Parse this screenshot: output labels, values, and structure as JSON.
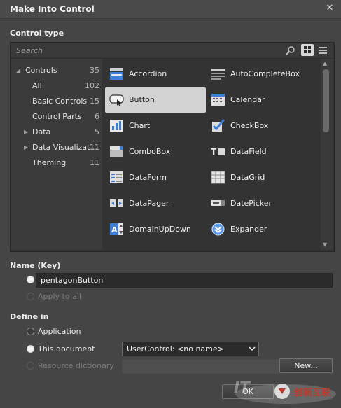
{
  "dialog": {
    "title": "Make Into Control",
    "close_glyph": "✕"
  },
  "control_type": {
    "heading": "Control type",
    "search_placeholder": "Search",
    "tree": [
      {
        "label": "Controls",
        "count": "35",
        "arrow": "◢"
      },
      {
        "label": "All",
        "count": "102"
      },
      {
        "label": "Basic Controls",
        "count": "15"
      },
      {
        "label": "Control Parts",
        "count": "6"
      },
      {
        "label": "Data",
        "count": "5",
        "arrow": "▶"
      },
      {
        "label": "Data Visualizat...",
        "count": "11",
        "arrow": "▶"
      },
      {
        "label": "Theming",
        "count": "11"
      }
    ],
    "items": [
      {
        "label": "Accordion",
        "icon": "accordion-icon"
      },
      {
        "label": "AutoCompleteBox",
        "icon": "autocompletebox-icon"
      },
      {
        "label": "Button",
        "icon": "button-icon",
        "selected": true
      },
      {
        "label": "Calendar",
        "icon": "calendar-icon"
      },
      {
        "label": "Chart",
        "icon": "chart-icon"
      },
      {
        "label": "CheckBox",
        "icon": "checkbox-icon"
      },
      {
        "label": "ComboBox",
        "icon": "combobox-icon"
      },
      {
        "label": "DataField",
        "icon": "datafield-icon"
      },
      {
        "label": "DataForm",
        "icon": "dataform-icon"
      },
      {
        "label": "DataGrid",
        "icon": "datagrid-icon"
      },
      {
        "label": "DataPager",
        "icon": "datapager-icon"
      },
      {
        "label": "DatePicker",
        "icon": "datepicker-icon"
      },
      {
        "label": "DomainUpDown",
        "icon": "domainupdown-icon"
      },
      {
        "label": "Expander",
        "icon": "expander-icon"
      }
    ],
    "scroll_up": "▲",
    "scroll_down": "▼"
  },
  "name_key": {
    "heading": "Name (Key)",
    "value": "pentagonButton",
    "apply_to_all": "Apply to all"
  },
  "define_in": {
    "heading": "Define in",
    "application": "Application",
    "this_document": "This document",
    "this_document_value": "UserControl: <no name>",
    "resource_dictionary": "Resource dictionary",
    "new_button": "New..."
  },
  "footer": {
    "ok_label": "OK",
    "watermark_text": "创新互联",
    "watermark_sub": "CHUANG XIN HU LIAN"
  },
  "colors": {
    "accent": "#3c7fd8",
    "selected_cell": "#d2d2d2"
  }
}
